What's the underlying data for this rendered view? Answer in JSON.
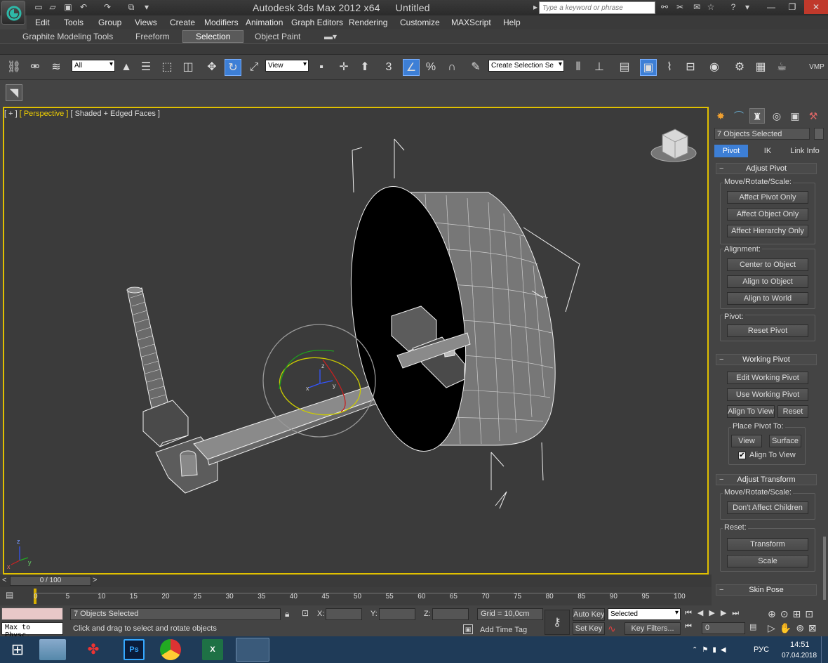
{
  "app": {
    "title": "Autodesk 3ds Max  2012 x64",
    "document": "Untitled",
    "search_placeholder": "Type a keyword or phrase"
  },
  "menu": [
    "Edit",
    "Tools",
    "Group",
    "Views",
    "Create",
    "Modifiers",
    "Animation",
    "Graph Editors",
    "Rendering",
    "Customize",
    "MAXScript",
    "Help"
  ],
  "ribbon_tabs": [
    "Graphite Modeling Tools",
    "Freeform",
    "Selection",
    "Object Paint"
  ],
  "toolbar": {
    "filter_value": "All",
    "ref_coord_value": "View",
    "named_selection_placeholder": "Create Selection Se",
    "snap_label": "3",
    "percent_label": "%",
    "vmp_label": "VMP"
  },
  "viewport": {
    "label_plus": "[ + ]",
    "label_view": "[ Perspective ]",
    "label_shading": "[ Shaded + Edged Faces ]",
    "axis_z": "z",
    "axis_y": "y",
    "axis_x": "x",
    "gizmo_z": "z",
    "gizmo_y": "y",
    "gizmo_x": "x"
  },
  "command_panel": {
    "selection_name": "7 Objects Selected",
    "tabs": [
      "Pivot",
      "IK",
      "Link Info"
    ],
    "adjust_pivot": {
      "header": "Adjust Pivot",
      "move_rotate_scale": "Move/Rotate/Scale:",
      "buttons": [
        "Affect Pivot Only",
        "Affect Object Only",
        "Affect Hierarchy Only"
      ],
      "alignment": "Alignment:",
      "align_buttons": [
        "Center to Object",
        "Align to Object",
        "Align to World"
      ],
      "pivot": "Pivot:",
      "reset_pivot": "Reset Pivot"
    },
    "working_pivot": {
      "header": "Working Pivot",
      "edit": "Edit Working Pivot",
      "use": "Use Working Pivot",
      "align_to_view": "Align To View",
      "reset": "Reset",
      "place_pivot_to": "Place Pivot To:",
      "view": "View",
      "surface": "Surface",
      "align_to_view_check": "Align To View"
    },
    "adjust_transform": {
      "header": "Adjust Transform",
      "move_rotate_scale": "Move/Rotate/Scale:",
      "dont_affect": "Don't Affect Children",
      "reset": "Reset:",
      "transform": "Transform",
      "scale": "Scale"
    },
    "skin_pose": "Skin Pose"
  },
  "timeline": {
    "frame": "0 / 100",
    "ticks": [
      "0",
      "5",
      "10",
      "15",
      "20",
      "25",
      "30",
      "35",
      "40",
      "45",
      "50",
      "55",
      "60",
      "65",
      "70",
      "75",
      "80",
      "85",
      "90",
      "95",
      "100"
    ]
  },
  "status": {
    "maxscript": "Max to Physc.",
    "objects_selected": "7 Objects Selected",
    "prompt": "Click and drag to select and rotate objects",
    "x_label": "X:",
    "y_label": "Y:",
    "z_label": "Z:",
    "grid": "Grid = 10,0cm",
    "add_time_tag": "Add Time Tag",
    "auto_key": "Auto Key",
    "set_key": "Set Key",
    "selected": "Selected",
    "key_filters": "Key Filters...",
    "frame_value": "0"
  },
  "taskbar": {
    "lang": "РУС",
    "time": "14:51",
    "date": "07.04.2018"
  },
  "colors": {
    "viewport_border": "#e0c000",
    "active_blue": "#3d7fd6",
    "taskbar": "#1f3b58"
  }
}
